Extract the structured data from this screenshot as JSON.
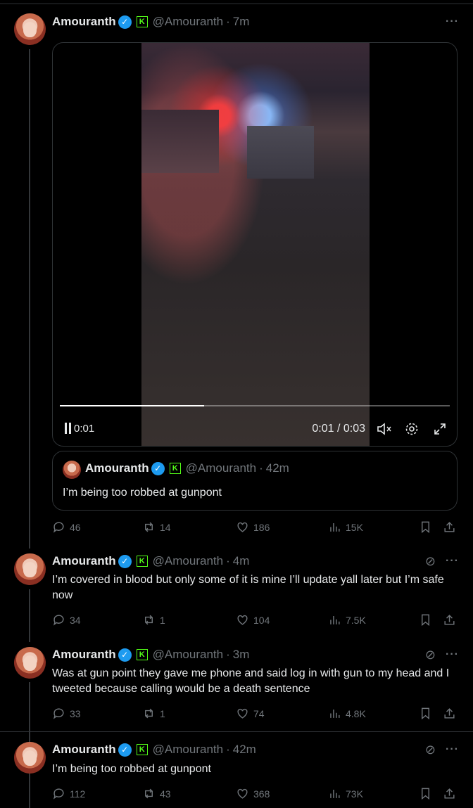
{
  "tweets": [
    {
      "name": "Amouranth",
      "handle": "@Amouranth",
      "time": "7m",
      "text": "",
      "video": {
        "time_left": "0:01",
        "time_right": "0:01 / 0:03",
        "progress": 0.37
      },
      "quote": {
        "name": "Amouranth",
        "handle": "@Amouranth",
        "time": "42m",
        "text": "I’m being too robbed at gunpont"
      },
      "replies": "46",
      "reposts": "14",
      "likes": "186",
      "views": "15K"
    },
    {
      "name": "Amouranth",
      "handle": "@Amouranth",
      "time": "4m",
      "text": "I’m covered in blood but only some of it is mine I’ll update yall later but I’m safe now",
      "replies": "34",
      "reposts": "1",
      "likes": "104",
      "views": "7.5K"
    },
    {
      "name": "Amouranth",
      "handle": "@Amouranth",
      "time": "3m",
      "text": "Was at gun point they gave me phone and said log in with gun to my head and I tweeted because calling would be a death sentence",
      "replies": "33",
      "reposts": "1",
      "likes": "74",
      "views": "4.8K"
    },
    {
      "name": "Amouranth",
      "handle": "@Amouranth",
      "time": "42m",
      "text": "I’m being too robbed at gunpont",
      "replies": "112",
      "reposts": "43",
      "likes": "368",
      "views": "73K"
    }
  ],
  "symbols": {
    "dot": "·",
    "more": "···",
    "verified": "✓",
    "kick": "K",
    "grok": "⊘"
  },
  "colors": {
    "verified": "#1d9bf0",
    "kick": "#53fc18",
    "muted": "#71767b",
    "text": "#e7e9ea"
  }
}
